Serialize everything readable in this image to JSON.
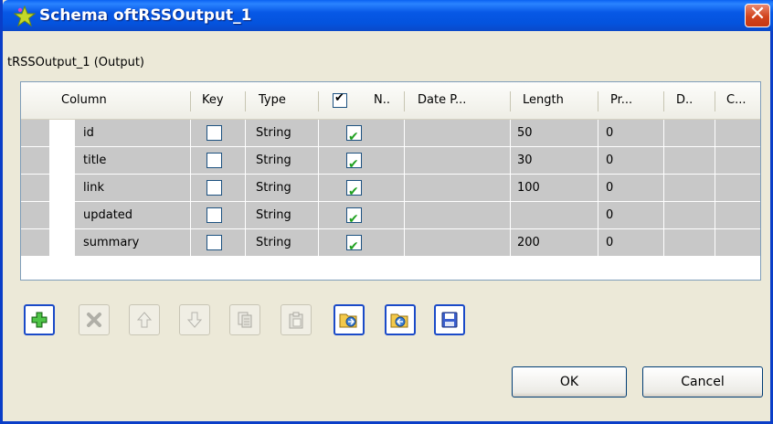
{
  "window": {
    "title": "Schema oftRSSOutput_1",
    "close_label": "✕"
  },
  "subtitle": "tRSSOutput_1 (Output)",
  "table": {
    "columns": [
      "Column",
      "Key",
      "Type",
      "",
      "N..",
      "Date P...",
      "Length",
      "Pr...",
      "D..",
      "C..."
    ],
    "rows": [
      {
        "column": "id",
        "key": false,
        "type": "String",
        "nullable": true,
        "date_pattern": "",
        "length": "50",
        "precision": "0",
        "default": "",
        "comment": ""
      },
      {
        "column": "title",
        "key": false,
        "type": "String",
        "nullable": true,
        "date_pattern": "",
        "length": "30",
        "precision": "0",
        "default": "",
        "comment": ""
      },
      {
        "column": "link",
        "key": false,
        "type": "String",
        "nullable": true,
        "date_pattern": "",
        "length": "100",
        "precision": "0",
        "default": "",
        "comment": ""
      },
      {
        "column": "updated",
        "key": false,
        "type": "String",
        "nullable": true,
        "date_pattern": "",
        "length": "",
        "precision": "0",
        "default": "",
        "comment": ""
      },
      {
        "column": "summary",
        "key": false,
        "type": "String",
        "nullable": true,
        "date_pattern": "",
        "length": "200",
        "precision": "0",
        "default": "",
        "comment": ""
      }
    ]
  },
  "toolbar": [
    {
      "name": "add-row-button",
      "icon": "plus-icon",
      "enabled": true
    },
    {
      "name": "remove-row-button",
      "icon": "x-icon",
      "enabled": false
    },
    {
      "name": "move-up-button",
      "icon": "arrow-up-icon",
      "enabled": false
    },
    {
      "name": "move-down-button",
      "icon": "arrow-down-icon",
      "enabled": false
    },
    {
      "name": "copy-button",
      "icon": "copy-icon",
      "enabled": false
    },
    {
      "name": "paste-button",
      "icon": "paste-icon",
      "enabled": false
    },
    {
      "name": "import-schema-button",
      "icon": "import-folder-icon",
      "enabled": true
    },
    {
      "name": "export-schema-button",
      "icon": "export-folder-icon",
      "enabled": true
    },
    {
      "name": "save-schema-button",
      "icon": "floppy-disk-icon",
      "enabled": true
    }
  ],
  "buttons": {
    "ok_label": "OK",
    "cancel_label": "Cancel"
  },
  "colors": {
    "titlebar": "#0453de",
    "row_background": "#c8c8c8",
    "check_green": "#21a121"
  }
}
